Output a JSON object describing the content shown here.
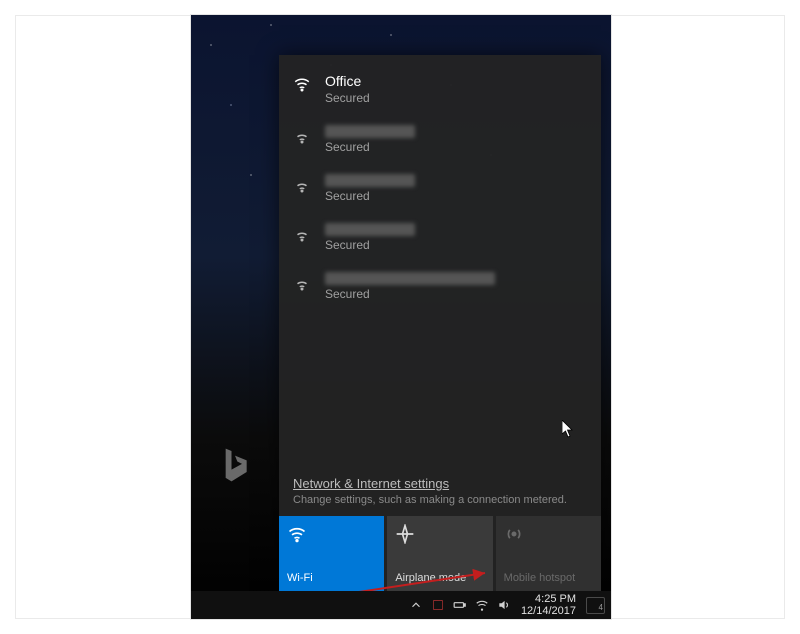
{
  "flyout": {
    "networks": [
      {
        "name": "Office",
        "status": "Secured",
        "strength": "full",
        "blurred": false
      },
      {
        "name": "",
        "status": "Secured",
        "strength": "weak",
        "blurred": true,
        "blur_wide": false
      },
      {
        "name": "",
        "status": "Secured",
        "strength": "weak",
        "blurred": true,
        "blur_wide": false
      },
      {
        "name": "",
        "status": "Secured",
        "strength": "weak",
        "blurred": true,
        "blur_wide": false
      },
      {
        "name": "",
        "status": "Secured",
        "strength": "weak",
        "blurred": true,
        "blur_wide": true
      }
    ],
    "settings_link": "Network & Internet settings",
    "settings_sub": "Change settings, such as making a connection metered.",
    "tiles": {
      "wifi": "Wi-Fi",
      "airplane": "Airplane mode",
      "hotspot": "Mobile hotspot"
    }
  },
  "taskbar": {
    "time": "4:25 PM",
    "date": "12/14/2017",
    "action_center_count": "4"
  },
  "desktop": {
    "brand": "Bing"
  }
}
